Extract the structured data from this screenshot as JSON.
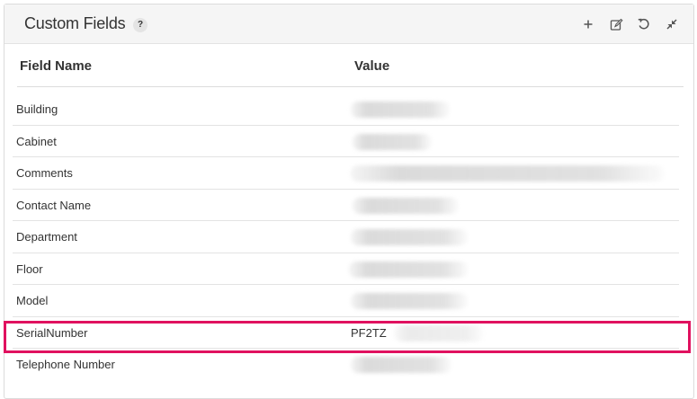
{
  "panel": {
    "title": "Custom Fields",
    "help_label": "?"
  },
  "toolbar": {
    "icons": [
      "add-icon",
      "edit-icon",
      "refresh-icon",
      "collapse-icon"
    ]
  },
  "table": {
    "headers": {
      "field_name": "Field Name",
      "value": "Value"
    },
    "rows": [
      {
        "name": "Building",
        "value": ""
      },
      {
        "name": "Cabinet",
        "value": ""
      },
      {
        "name": "Comments",
        "value": ""
      },
      {
        "name": "Contact Name",
        "value": ""
      },
      {
        "name": "Department",
        "value": ""
      },
      {
        "name": "Floor",
        "value": ""
      },
      {
        "name": "Model",
        "value": ""
      },
      {
        "name": "SerialNumber",
        "value": "PF2TZ"
      },
      {
        "name": "Telephone Number",
        "value": ""
      }
    ]
  },
  "colors": {
    "highlight": "#e0115f",
    "header_bg": "#f5f5f5"
  }
}
